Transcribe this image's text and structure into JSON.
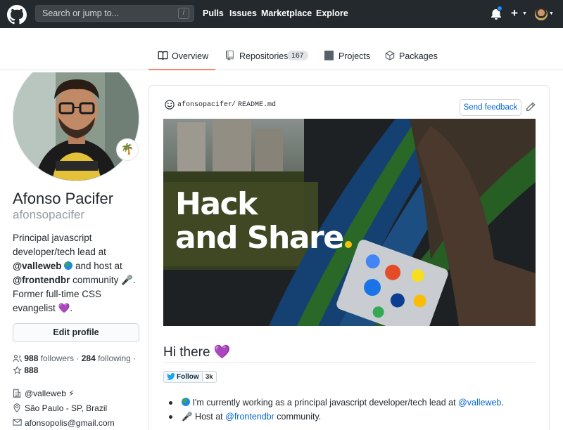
{
  "header": {
    "search_placeholder": "Search or jump to...",
    "search_key": "/",
    "nav": [
      "Pulls",
      "Issues",
      "Marketplace",
      "Explore"
    ],
    "plus": "+"
  },
  "tabs": [
    {
      "label": "Overview",
      "active": true
    },
    {
      "label": "Repositories",
      "count": "167"
    },
    {
      "label": "Projects"
    },
    {
      "label": "Packages"
    }
  ],
  "profile": {
    "status_emoji": "🌴",
    "name": "Afonso Pacifer",
    "login": "afonsopacifer",
    "bio_1": "Principal javascript developer/tech lead at ",
    "bio_mention_1": "@valleweb",
    "bio_2": " and host at ",
    "bio_mention_2": "@frontendbr",
    "bio_3": " community ",
    "bio_mic": "🎤",
    "bio_4": ". Former full-time CSS evangelist ",
    "bio_heart": "💜",
    "bio_5": ".",
    "edit_button": "Edit profile",
    "followers_count": "988",
    "followers_label": " followers · ",
    "following_count": "284",
    "following_label": " following · ",
    "stars": "888",
    "company": "@valleweb ⚡",
    "location": "São Paulo - SP, Brazil",
    "email": "afonsopolis@gmail.com"
  },
  "readme": {
    "owner": "afonsopacifer",
    "sep": "/",
    "file": "README.md",
    "feedback": "Send feedback",
    "banner_line1": "Hack",
    "banner_line2": "and Share",
    "greeting": "Hi there 💜",
    "twitter_follow": "Follow",
    "twitter_count": "3k",
    "bullet1_pre": " I'm currently working as a principal javascript developer/tech lead at ",
    "bullet1_link": "@valleweb",
    "bullet1_post": ".",
    "bullet2_emoji": "🎤",
    "bullet2_pre": " Host at ",
    "bullet2_link": "@frontendbr",
    "bullet2_post": " community."
  },
  "colors": {
    "header_bg": "#24292e",
    "accent_tab": "#f9826c",
    "link": "#0366d6"
  }
}
